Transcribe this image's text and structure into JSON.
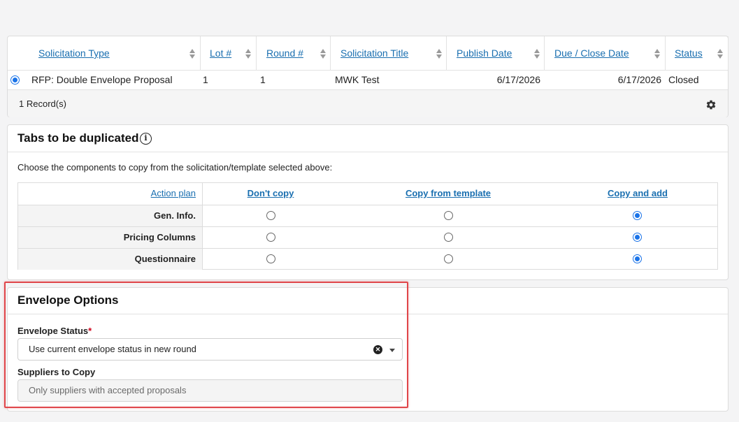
{
  "grid": {
    "columns": [
      {
        "label": "Solicitation Type"
      },
      {
        "label": "Lot #"
      },
      {
        "label": "Round #"
      },
      {
        "label": "Solicitation Title"
      },
      {
        "label": "Publish Date"
      },
      {
        "label": "Due / Close Date"
      },
      {
        "label": "Status"
      }
    ],
    "rows": [
      {
        "type": "RFP: Double Envelope Proposal",
        "lot": "1",
        "round": "1",
        "title": "MWK Test",
        "publish_date": "6/17/2026",
        "due_date": "6/17/2026",
        "status": "Closed",
        "selected": true
      }
    ],
    "record_count": "1 Record(s)"
  },
  "tabs_panel": {
    "title": "Tabs to be duplicated",
    "description": "Choose the components to copy from the solicitation/template selected above:",
    "action_plan": "Action plan",
    "options": [
      "Don't copy",
      "Copy from template",
      "Copy and add"
    ],
    "rows": [
      {
        "label": "Gen. Info.",
        "selected": "Copy and add"
      },
      {
        "label": "Pricing Columns",
        "selected": "Copy and add"
      },
      {
        "label": "Questionnaire",
        "selected": "Copy and add"
      }
    ]
  },
  "envelope": {
    "title": "Envelope Options",
    "status_label": "Envelope Status",
    "required_mark": "*",
    "status_value": "Use current envelope status in new round",
    "suppliers_label": "Suppliers to Copy",
    "suppliers_value": "Only suppliers with accepted proposals"
  },
  "colors": {
    "link": "#1a6fb0",
    "radio_selected": "#1a73e8",
    "highlight": "#e0464a",
    "required": "#d0021b"
  },
  "icons": [
    "sort-icon",
    "gear-icon",
    "info-icon",
    "clear-icon",
    "chevron-down-icon"
  ]
}
